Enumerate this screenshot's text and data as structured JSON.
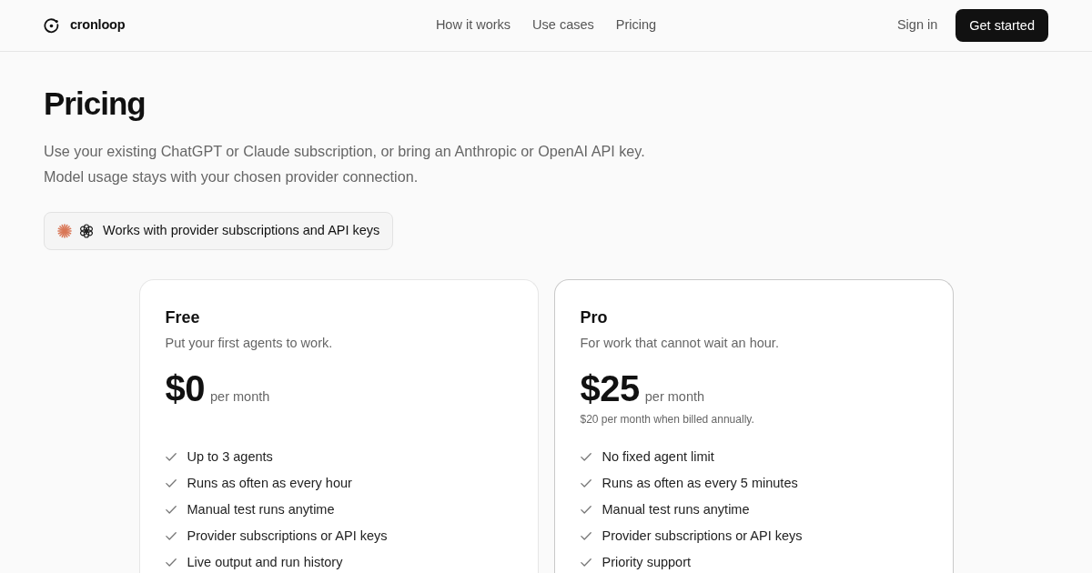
{
  "nav": {
    "brand": "cronloop",
    "links": [
      {
        "label": "How it works"
      },
      {
        "label": "Use cases"
      },
      {
        "label": "Pricing"
      }
    ],
    "sign_in": "Sign in",
    "cta": "Get started"
  },
  "hero": {
    "title": "Pricing",
    "lines": [
      "Use your existing ChatGPT or Claude subscription, or bring an Anthropic or OpenAI API key.",
      "Model usage stays with your chosen provider connection."
    ],
    "chip": {
      "label": "Works with provider subscriptions and API keys"
    }
  },
  "plans": [
    {
      "name": "Free",
      "description": "Put your first agents to work.",
      "price": "$0",
      "period": "per month",
      "highlighted": false,
      "features": [
        "Up to 3 agents",
        "Runs as often as every hour",
        "Manual test runs anytime",
        "Provider subscriptions or API keys",
        "Live output and run history"
      ]
    },
    {
      "name": "Pro",
      "description": "For work that cannot wait an hour.",
      "price": "$25",
      "period": "per month",
      "annual_note": "$20 per month when billed annually.",
      "highlighted": true,
      "features": [
        "No fixed agent limit",
        "Runs as often as every 5 minutes",
        "Manual test runs anytime",
        "Provider subscriptions or API keys",
        "Priority support"
      ]
    }
  ]
}
